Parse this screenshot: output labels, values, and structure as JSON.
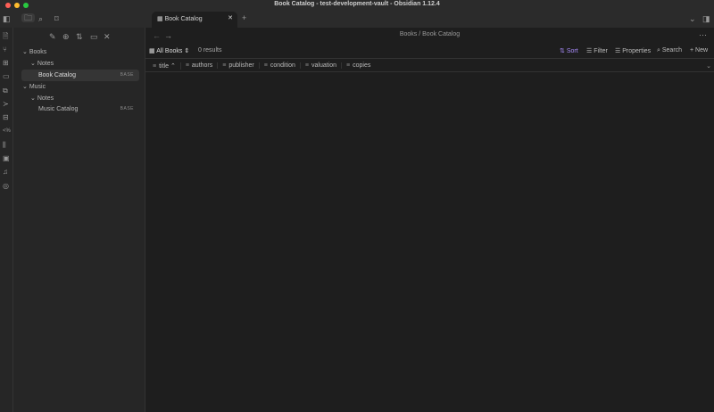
{
  "window": {
    "title": "Book Catalog - test-development-vault - Obsidian 1.12.4"
  },
  "tabs": [
    {
      "label": "Book Catalog"
    }
  ],
  "breadcrumb": {
    "folder": "Books",
    "separator": "/",
    "file": "Book Catalog"
  },
  "sidebar": {
    "tree": [
      {
        "label": "Books"
      },
      {
        "label": "Notes"
      },
      {
        "label": "Book Catalog",
        "badge": "BASE"
      },
      {
        "label": "Music"
      },
      {
        "label": "Notes"
      },
      {
        "label": "Music Catalog",
        "badge": "BASE"
      }
    ]
  },
  "base": {
    "view": "All Books",
    "results": "0 results",
    "actions": {
      "sort": "Sort",
      "filter": "Filter",
      "properties": "Properties",
      "search": "Search",
      "new": "New"
    },
    "columns": [
      "title",
      "authors",
      "publisher",
      "condition",
      "valuation",
      "copies"
    ]
  },
  "colors": {
    "accent": "#a88bfa"
  }
}
